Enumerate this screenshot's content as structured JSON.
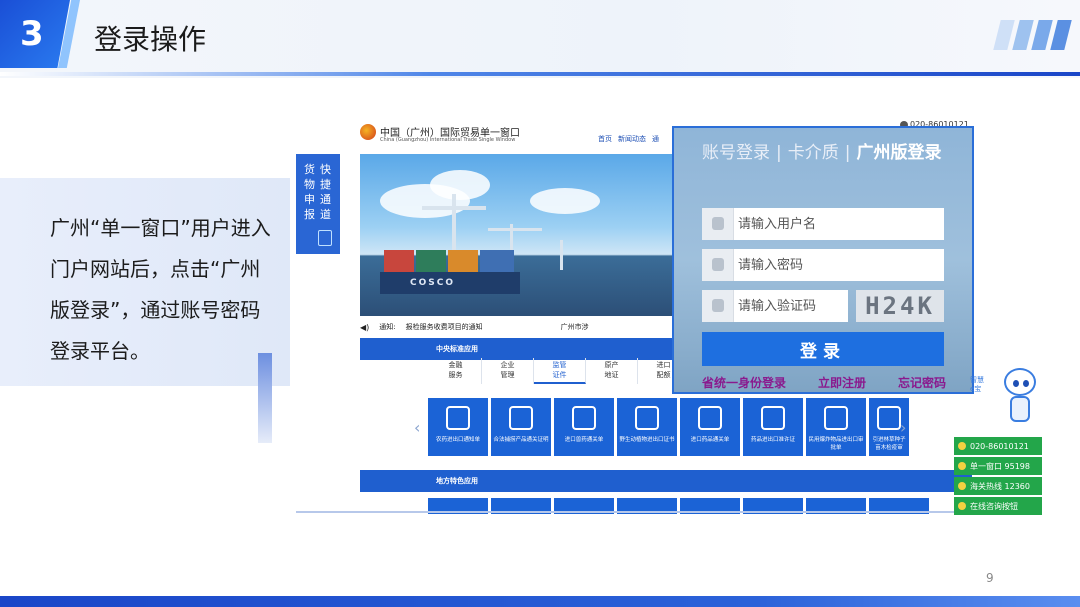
{
  "slide": {
    "number": "3",
    "title": "登录操作",
    "page_number": "9",
    "description": "广州“单一窗口”用户进入门户网站后，点击“广州版登录”，通过账号密码登录平台。",
    "colors": {
      "accent": "#1a4fd6",
      "band": "#1f5fcf",
      "contact_green": "#23a64a",
      "link_purple": "#8a1a8e"
    }
  },
  "portal": {
    "name": "中国（广州）国际贸易单一窗口",
    "name_en": "China (Guangzhou) International Trade Single Window",
    "nav": [
      "首页",
      "新闻动态",
      "通"
    ],
    "phone": "020-86010121",
    "quick_tab": [
      "快",
      "货",
      "捷",
      "物",
      "通",
      "申",
      "道",
      "报"
    ],
    "banner_text": "COSCO",
    "notice_label": "通知:",
    "notice_text": "报检服务收费项目的通知",
    "notice_more": "广州市涉",
    "central_label": "中央标准应用",
    "categories": [
      {
        "l1": "金融",
        "l2": "服务",
        "active": false
      },
      {
        "l1": "企业",
        "l2": "管理",
        "active": false
      },
      {
        "l1": "监管",
        "l2": "证件",
        "active": true
      },
      {
        "l1": "原产",
        "l2": "地证",
        "active": false
      },
      {
        "l1": "进口",
        "l2": "配额",
        "active": false
      }
    ],
    "tiles": [
      "农药进出口通知单",
      "合法捕捞产品通关证明",
      "进口兽药通关单",
      "野生动植物进出口证书",
      "进口药品通关单",
      "药品进出口准许证",
      "民用爆炸物品进出口审批单",
      "引进林草种子苗木检疫审"
    ],
    "local_label": "地方特色应用"
  },
  "login": {
    "tab_account": "账号登录",
    "tab_card": "卡介质",
    "tab_guangzhou": "广州版登录",
    "separator": "|",
    "username_placeholder": "请输入用户名",
    "password_placeholder": "请输入密码",
    "captcha_placeholder": "请输入验证码",
    "captcha_text": "H24K",
    "submit": "登录",
    "link_unified": "省统一身份登录",
    "link_register": "立即注册",
    "link_forgot": "忘记密码"
  },
  "contacts": [
    {
      "label": "020-86010121"
    },
    {
      "label": "单一窗口  95198"
    },
    {
      "label": "海关热线  12360"
    },
    {
      "label": "在线咨询按钮"
    }
  ],
  "robot_label": [
    "智慧",
    "e宝"
  ]
}
